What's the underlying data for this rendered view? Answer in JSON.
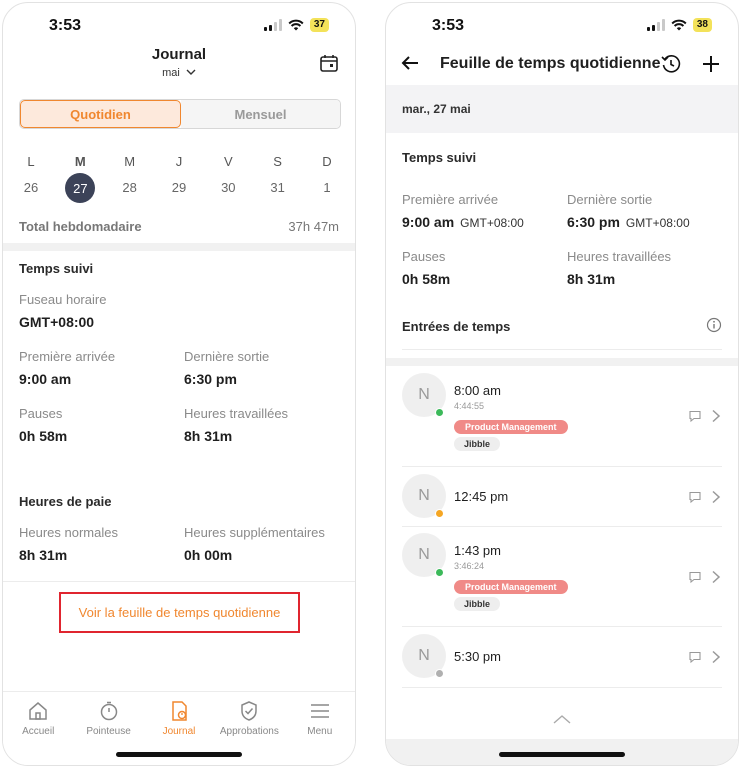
{
  "left": {
    "status": {
      "time": "3:53",
      "battery": "37"
    },
    "title": "Journal",
    "subtitle": "mai",
    "tabs": [
      "Quotidien",
      "Mensuel"
    ],
    "week_letters": [
      "L",
      "M",
      "M",
      "J",
      "V",
      "S",
      "D"
    ],
    "week_days": [
      "26",
      "27",
      "28",
      "29",
      "30",
      "31",
      "1"
    ],
    "selected_day": "27",
    "total_label": "Total hebdomadaire",
    "total_value": "37h 47m",
    "tracked": {
      "title": "Temps suivi",
      "timezone_label": "Fuseau horaire",
      "timezone_value": "GMT+08:00",
      "first_in_label": "Première arrivée",
      "first_in_value": "9:00 am",
      "last_out_label": "Dernière sortie",
      "last_out_value": "6:30 pm",
      "breaks_label": "Pauses",
      "breaks_value": "0h 58m",
      "worked_label": "Heures travaillées",
      "worked_value": "8h 31m"
    },
    "pay": {
      "title": "Heures de paie",
      "regular_label": "Heures normales",
      "regular_value": "8h 31m",
      "overtime_label": "Heures supplémentaires",
      "overtime_value": "0h 00m"
    },
    "daily_link": "Voir la feuille de temps quotidienne",
    "nav": [
      {
        "label": "Accueil",
        "icon": "home-icon"
      },
      {
        "label": "Pointeuse",
        "icon": "stopwatch-icon"
      },
      {
        "label": "Journal",
        "icon": "journal-icon"
      },
      {
        "label": "Approbations",
        "icon": "shield-check-icon"
      },
      {
        "label": "Menu",
        "icon": "menu-icon"
      }
    ]
  },
  "right": {
    "status": {
      "time": "3:53",
      "battery": "38"
    },
    "title": "Feuille de temps quotidienne",
    "date": "mar., 27 mai",
    "tracked": {
      "title": "Temps suivi",
      "first_in_label": "Première arrivée",
      "first_in_value": "9:00 am",
      "first_in_tz": "GMT+08:00",
      "last_out_label": "Dernière sortie",
      "last_out_value": "6:30 pm",
      "last_out_tz": "GMT+08:00",
      "breaks_label": "Pauses",
      "breaks_value": "0h 58m",
      "worked_label": "Heures travaillées",
      "worked_value": "8h 31m"
    },
    "entries_title": "Entrées de temps",
    "entries": [
      {
        "avatar": "N",
        "time": "8:00 am",
        "duration": "4:44:55",
        "activity": "Product Management",
        "project": "Jibble",
        "status_color": "#3cb95a"
      },
      {
        "avatar": "N",
        "time": "12:45 pm",
        "status_color": "#f5a623"
      },
      {
        "avatar": "N",
        "time": "1:43 pm",
        "duration": "3:46:24",
        "activity": "Product Management",
        "project": "Jibble",
        "status_color": "#3cb95a"
      },
      {
        "avatar": "N",
        "time": "5:30 pm",
        "status_color": "#b0b0b0"
      }
    ]
  },
  "colors": {
    "accent": "#f0872f",
    "selected_day": "#3c4358",
    "highlight_box": "#e0252f",
    "tag_activity": "#f08a87"
  }
}
